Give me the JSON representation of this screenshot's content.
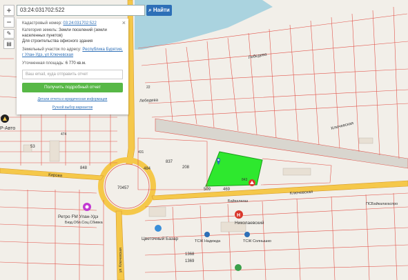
{
  "search": {
    "value": "03:24:031702:522",
    "button_label": "Найти"
  },
  "controls": {
    "zoom_in": "+",
    "zoom_out": "−"
  },
  "popup": {
    "cadastral_label": "Кадастровый номер:",
    "cadastral_number": "03:24:031702:522",
    "category_label": "Категория земель:",
    "category_value": "Земли поселений (земли населенных пунктов)",
    "use_value": "Для строительства офисного здания",
    "address_label": "Земельный участок по адресу:",
    "address_value": "Республика Бурятия, г Улан-Удэ, ул Ключевская",
    "area_label": "Уточненная площадь:",
    "area_value": "6 770 кв.м.",
    "email_placeholder": "Ваш email, куда отправить отчет",
    "report_button": "Получить подробный отчет",
    "report_details_link": "Детали отчета и юридическая информация",
    "manual_link": "Ручной выбор вариантов"
  },
  "map": {
    "colors": {
      "parcel_fill": "#2ee82e",
      "road_yellow": "#f5c84a",
      "water": "#aad3df",
      "boundary": "#e2554c"
    },
    "streets": [
      "Лебедева",
      "Лебедева",
      "Ключевская",
      "Ключевская",
      "Кирова",
      "ул. Ключевская"
    ],
    "places": [
      "Р-Авто",
      "Ретро FM Улан-Удэ",
      "Бюд.Обл.Соц.Сбивка",
      "Николаевский",
      "Цветочный Базар",
      "ТСЖ Надежда",
      "ТСЖ Солнышко",
      "ПСБайкалагаспро",
      "Байкалагаз"
    ],
    "parcel_numbers": [
      "208",
      "469",
      "509",
      "843",
      "70457",
      "431",
      "837",
      "484",
      "848",
      "53",
      "474",
      "1368",
      "1369",
      "22"
    ]
  }
}
